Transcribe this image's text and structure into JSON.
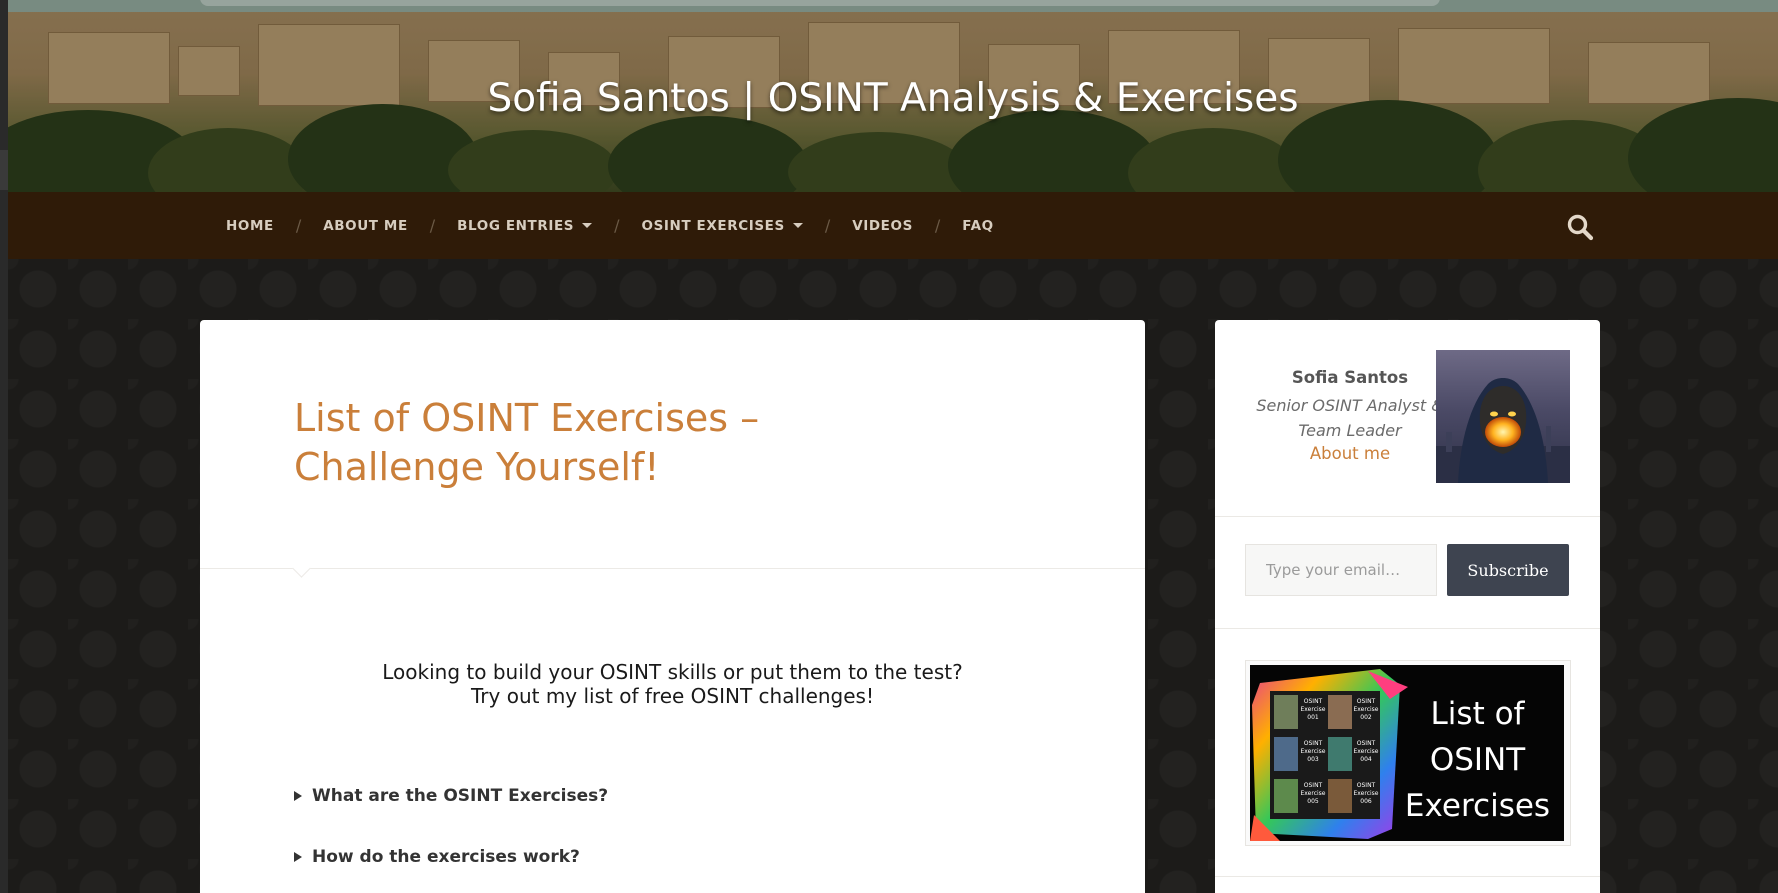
{
  "site": {
    "title": "Sofia Santos | OSINT Analysis & Exercises"
  },
  "nav": {
    "items": [
      {
        "label": "HOME",
        "has_dropdown": false
      },
      {
        "label": "ABOUT ME",
        "has_dropdown": false
      },
      {
        "label": "BLOG ENTRIES",
        "has_dropdown": true
      },
      {
        "label": "OSINT EXERCISES",
        "has_dropdown": true
      },
      {
        "label": "VIDEOS",
        "has_dropdown": false
      },
      {
        "label": "FAQ",
        "has_dropdown": false
      }
    ],
    "separator": "/",
    "search_icon": "search-icon"
  },
  "post": {
    "title": "List of OSINT Exercises – Challenge Yourself!",
    "intro_line1": "Looking to build your OSINT skills or put them to the test?",
    "intro_line2": "Try out my list of free OSINT challenges!",
    "faq": [
      {
        "label": "What are the OSINT Exercises?"
      },
      {
        "label": "How do the exercises work?"
      }
    ]
  },
  "sidebar": {
    "author_name": "Sofia Santos",
    "author_role": "Senior OSINT Analyst & Team Leader",
    "about_link": "About me",
    "email_placeholder": "Type your email…",
    "subscribe_label": "Subscribe",
    "promo_text": "List of OSINT Exercises",
    "promo_thumbnails": [
      {
        "label": "OSINT Exercise 001"
      },
      {
        "label": "OSINT Exercise 002"
      },
      {
        "label": "OSINT Exercise 003"
      },
      {
        "label": "OSINT Exercise 004"
      },
      {
        "label": "OSINT Exercise 005"
      },
      {
        "label": "OSINT Exercise 006"
      }
    ]
  },
  "colors": {
    "accent": "#ca7f3a",
    "nav_bg": "#2f1b08",
    "button_bg": "#3e4450"
  }
}
